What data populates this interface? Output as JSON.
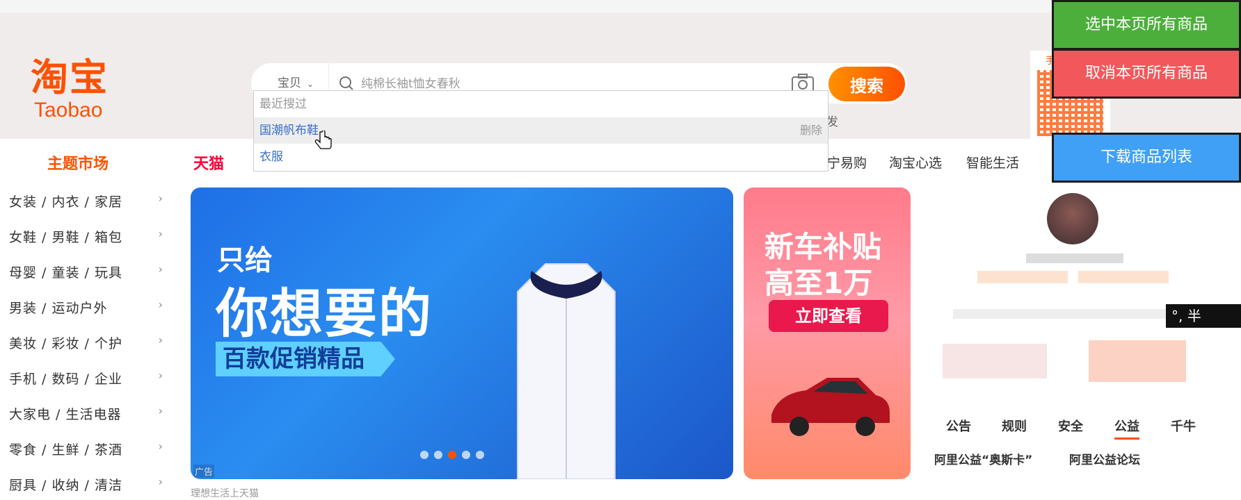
{
  "logo": {
    "cn": "淘宝",
    "en": "Taobao"
  },
  "search": {
    "type_label": "宝贝",
    "placeholder": "纯棉长袖t恤女春秋",
    "button_label": "搜索"
  },
  "hot_words_partial": "发",
  "dropdown": {
    "header": "最近搜过",
    "items": [
      {
        "label": "国潮帆布鞋",
        "delete": "删除"
      },
      {
        "label": "衣服"
      }
    ]
  },
  "side_buttons": [
    {
      "label": "选中本页所有商品",
      "color": "#4caf3b"
    },
    {
      "label": "取消本页所有商品",
      "color": "#f2585b"
    },
    {
      "label": "下载商品列表",
      "color": "#3fa0f5"
    }
  ],
  "qr": {
    "label": "手"
  },
  "nav": {
    "theme_market": "主题市场",
    "tmall": "天猫",
    "items": [
      "宁易购",
      "淘宝心选",
      "智能生活"
    ]
  },
  "categories": [
    "女装 / 内衣 / 家居",
    "女鞋 / 男鞋 / 箱包",
    "母婴 / 童装 / 玩具",
    "男装 / 运动户外",
    "美妆 / 彩妆 / 个护",
    "手机 / 数码 / 企业",
    "大家电 / 生活电器",
    "零食 / 生鲜 / 茶酒",
    "厨具 / 收纳 / 清洁"
  ],
  "banner": {
    "line1": "只给",
    "line2": "你想要的",
    "line3": "百款促销精品",
    "ad_label": "广告",
    "slides": 5,
    "active_slide": 3
  },
  "ad2": {
    "line1": "新车补贴",
    "line2": "高至1万",
    "button": "立即查看"
  },
  "member_tabs": [
    "公告",
    "规则",
    "安全",
    "公益",
    "千牛"
  ],
  "active_tab": "公益",
  "notices": [
    "阿里公益“奥斯卡”",
    "阿里公益论坛"
  ],
  "overlay_chip": "°, 半",
  "bottom_partial": "理想生活上天猫"
}
